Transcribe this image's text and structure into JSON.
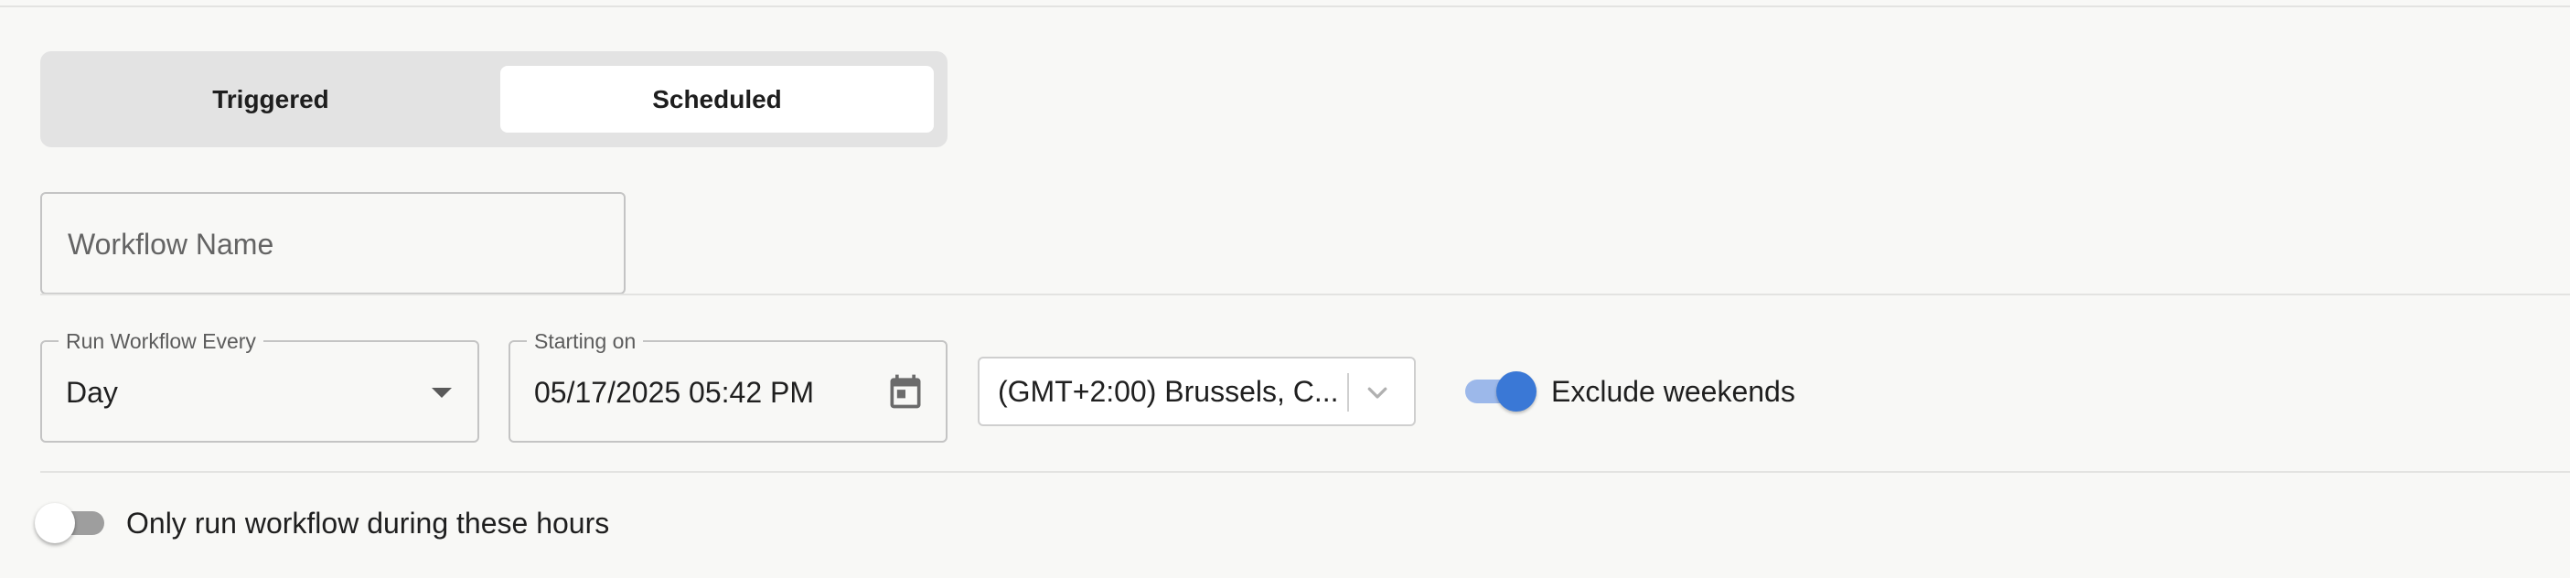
{
  "mode_toggle": {
    "options": [
      "Triggered",
      "Scheduled"
    ],
    "selected": "Scheduled"
  },
  "workflow_name": {
    "placeholder": "Workflow Name",
    "value": ""
  },
  "run_every": {
    "label": "Run Workflow Every",
    "value": "Day"
  },
  "starting_on": {
    "label": "Starting on",
    "value": "05/17/2025 05:42 PM"
  },
  "timezone": {
    "value": "(GMT+2:00) Brussels, C..."
  },
  "exclude_weekends": {
    "label": "Exclude weekends",
    "enabled": true
  },
  "only_hours": {
    "label": "Only run workflow during these hours",
    "enabled": false
  },
  "icons": {
    "date_picker": "calendar-icon",
    "timezone_dropdown": "chevron-down-icon",
    "run_every_dropdown": "caret-down-icon"
  },
  "colors": {
    "toggle_on_thumb": "#3a78d6",
    "toggle_on_track": "#9cb8ea",
    "toggle_off_track": "#9e9e9e",
    "selected_segment": "#ffffff",
    "segment_background": "#e3e3e3"
  }
}
